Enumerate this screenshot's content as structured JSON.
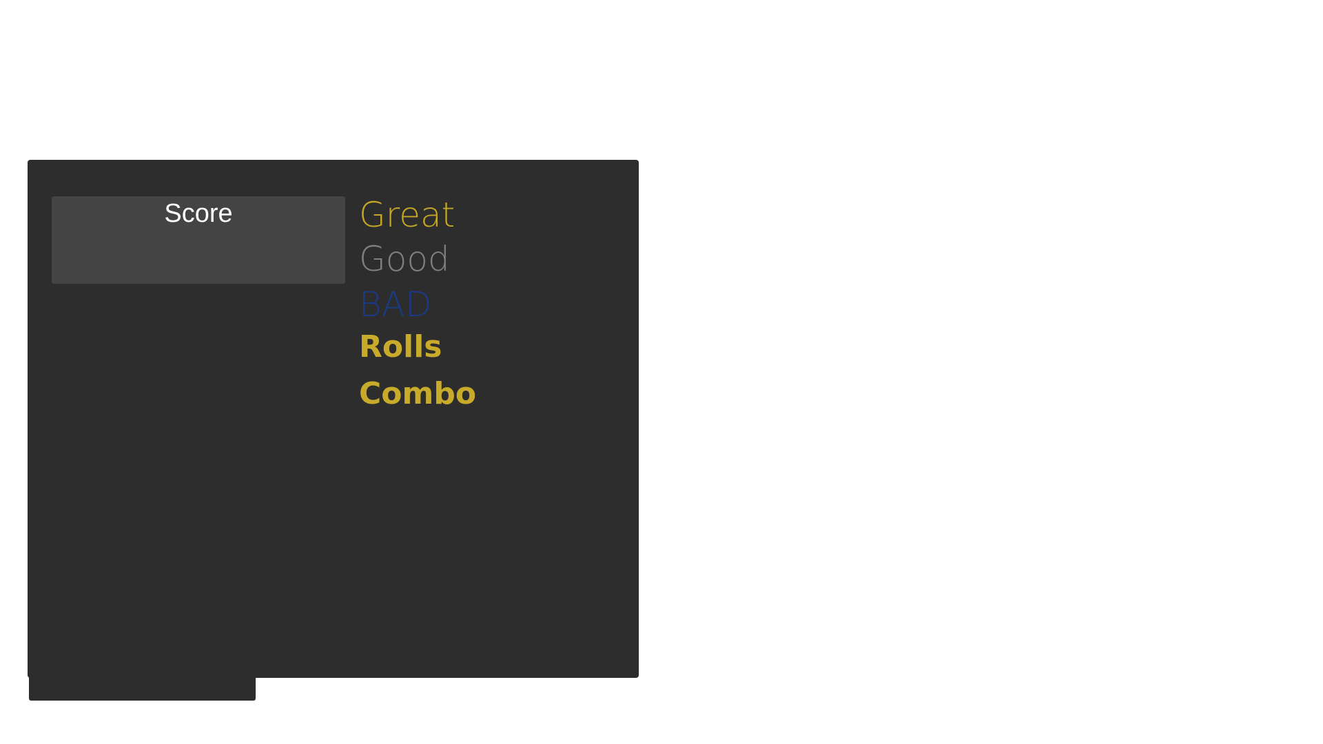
{
  "score": {
    "label": "Score"
  },
  "judgements": {
    "great": "Great",
    "good": "Good",
    "bad": "BAD",
    "rolls": "Rolls",
    "combo": "Combo"
  },
  "colors": {
    "panel_bg": "#2d2d2d",
    "score_box_bg": "#444444",
    "great": "#c5a724",
    "good": "#808080",
    "bad": "#1a3a86",
    "rolls": "#c9ab2b",
    "combo": "#c9ab2b"
  }
}
